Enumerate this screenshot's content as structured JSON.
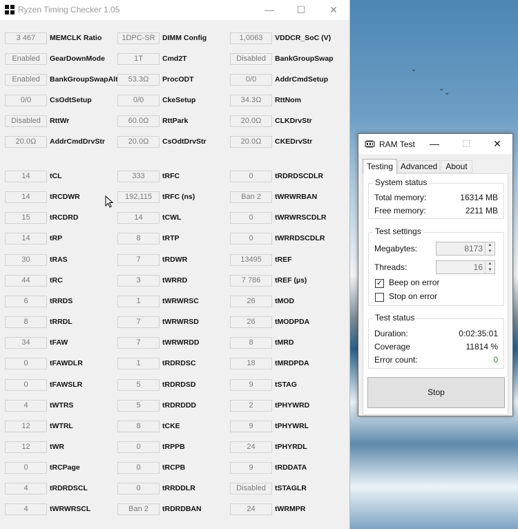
{
  "rtc": {
    "title": "Ryzen Timing Checker 1.05",
    "window_controls": {
      "minimize": "—",
      "maximize": "☐",
      "close": "✕"
    },
    "rows": [
      [
        {
          "value": "3 467",
          "label": "MEMCLK Ratio"
        },
        {
          "value": "1DPC-SR",
          "label": "DIMM Config"
        },
        {
          "value": "1,0063",
          "label": "VDDCR_SoC (V)"
        }
      ],
      [
        {
          "value": "Enabled",
          "label": "GearDownMode"
        },
        {
          "value": "1T",
          "label": "Cmd2T"
        },
        {
          "value": "Disabled",
          "label": "BankGroupSwap"
        }
      ],
      [
        {
          "value": "Enabled",
          "label": "BankGroupSwapAlt"
        },
        {
          "value": "53.3Ω",
          "label": "ProcODT"
        },
        {
          "value": "0/0",
          "label": "AddrCmdSetup"
        }
      ],
      [
        {
          "value": "0/0",
          "label": "CsOdtSetup"
        },
        {
          "value": "0/0",
          "label": "CkeSetup"
        },
        {
          "value": "34.3Ω",
          "label": "RttNom"
        }
      ],
      [
        {
          "value": "Disabled",
          "label": "RttWr"
        },
        {
          "value": "60.0Ω",
          "label": "RttPark"
        },
        {
          "value": "20.0Ω",
          "label": "CLKDrvStr"
        }
      ],
      [
        {
          "value": "20.0Ω",
          "label": "AddrCmdDrvStr"
        },
        {
          "value": "20.0Ω",
          "label": "CsOdtDrvStr"
        },
        {
          "value": "20.0Ω",
          "label": "CKEDrvStr"
        }
      ],
      [
        {
          "value": "14",
          "label": "tCL"
        },
        {
          "value": "333",
          "label": "tRFC"
        },
        {
          "value": "0",
          "label": "tRDRDSCDLR"
        }
      ],
      [
        {
          "value": "14",
          "label": "tRCDWR"
        },
        {
          "value": "192,115",
          "label": "tRFC (ns)"
        },
        {
          "value": "Ban 2",
          "label": "tWRWRBAN"
        }
      ],
      [
        {
          "value": "15",
          "label": "tRCDRD"
        },
        {
          "value": "14",
          "label": "tCWL"
        },
        {
          "value": "0",
          "label": "tWRWRSCDLR"
        }
      ],
      [
        {
          "value": "14",
          "label": "tRP"
        },
        {
          "value": "8",
          "label": "tRTP"
        },
        {
          "value": "0",
          "label": "tWRRDSCDLR"
        }
      ],
      [
        {
          "value": "30",
          "label": "tRAS"
        },
        {
          "value": "7",
          "label": "tRDWR"
        },
        {
          "value": "13495",
          "label": "tREF"
        }
      ],
      [
        {
          "value": "44",
          "label": "tRC"
        },
        {
          "value": "3",
          "label": "tWRRD"
        },
        {
          "value": "7 786",
          "label": "tREF (µs)"
        }
      ],
      [
        {
          "value": "6",
          "label": "tRRDS"
        },
        {
          "value": "1",
          "label": "tWRWRSC"
        },
        {
          "value": "26",
          "label": "tMOD"
        }
      ],
      [
        {
          "value": "8",
          "label": "tRRDL"
        },
        {
          "value": "7",
          "label": "tWRWRSD"
        },
        {
          "value": "26",
          "label": "tMODPDA"
        }
      ],
      [
        {
          "value": "34",
          "label": "tFAW"
        },
        {
          "value": "7",
          "label": "tWRWRDD"
        },
        {
          "value": "8",
          "label": "tMRD"
        }
      ],
      [
        {
          "value": "0",
          "label": "tFAWDLR"
        },
        {
          "value": "1",
          "label": "tRDRDSC"
        },
        {
          "value": "18",
          "label": "tMRDPDA"
        }
      ],
      [
        {
          "value": "0",
          "label": "tFAWSLR"
        },
        {
          "value": "5",
          "label": "tRDRDSD"
        },
        {
          "value": "9",
          "label": "tSTAG"
        }
      ],
      [
        {
          "value": "4",
          "label": "tWTRS"
        },
        {
          "value": "5",
          "label": "tRDRDDD"
        },
        {
          "value": "2",
          "label": "tPHYWRD"
        }
      ],
      [
        {
          "value": "12",
          "label": "tWTRL"
        },
        {
          "value": "8",
          "label": "tCKE"
        },
        {
          "value": "9",
          "label": "tPHYWRL"
        }
      ],
      [
        {
          "value": "12",
          "label": "tWR"
        },
        {
          "value": "0",
          "label": "tRPPB"
        },
        {
          "value": "24",
          "label": "tPHYRDL"
        }
      ],
      [
        {
          "value": "0",
          "label": "tRCPage"
        },
        {
          "value": "0",
          "label": "tRCPB"
        },
        {
          "value": "9",
          "label": "tRDDATA"
        }
      ],
      [
        {
          "value": "4",
          "label": "tRDRDSCL"
        },
        {
          "value": "0",
          "label": "tRRDDLR"
        },
        {
          "value": "Disabled",
          "label": "tSTAGLR"
        }
      ],
      [
        {
          "value": "4",
          "label": "tWRWRSCL"
        },
        {
          "value": "Ban 2",
          "label": "tRDRDBAN"
        },
        {
          "value": "24",
          "label": "tWRMPR"
        }
      ]
    ]
  },
  "ram": {
    "title": "RAM Test",
    "window_controls": {
      "minimize": "—",
      "maximize": "☐",
      "close": "✕"
    },
    "tabs": [
      "Testing",
      "Advanced",
      "About"
    ],
    "active_tab": "Testing",
    "system_status": {
      "heading": "System status",
      "total_label": "Total memory:",
      "total_value": "16314 MB",
      "free_label": "Free memory:",
      "free_value": "2211 MB"
    },
    "test_settings": {
      "heading": "Test settings",
      "megabytes_label": "Megabytes:",
      "megabytes_value": "8173",
      "threads_label": "Threads:",
      "threads_value": "16",
      "beep_label": "Beep on error",
      "beep_checked": true,
      "stop_label": "Stop on error",
      "stop_checked": false
    },
    "test_status": {
      "heading": "Test status",
      "duration_label": "Duration:",
      "duration_value": "0:02:35:01",
      "coverage_label": "Coverage",
      "coverage_value": "11814 %",
      "error_label": "Error count:",
      "error_value": "0"
    },
    "stop_button": "Stop",
    "colors": {
      "error_count": "#2e8b2e"
    }
  }
}
